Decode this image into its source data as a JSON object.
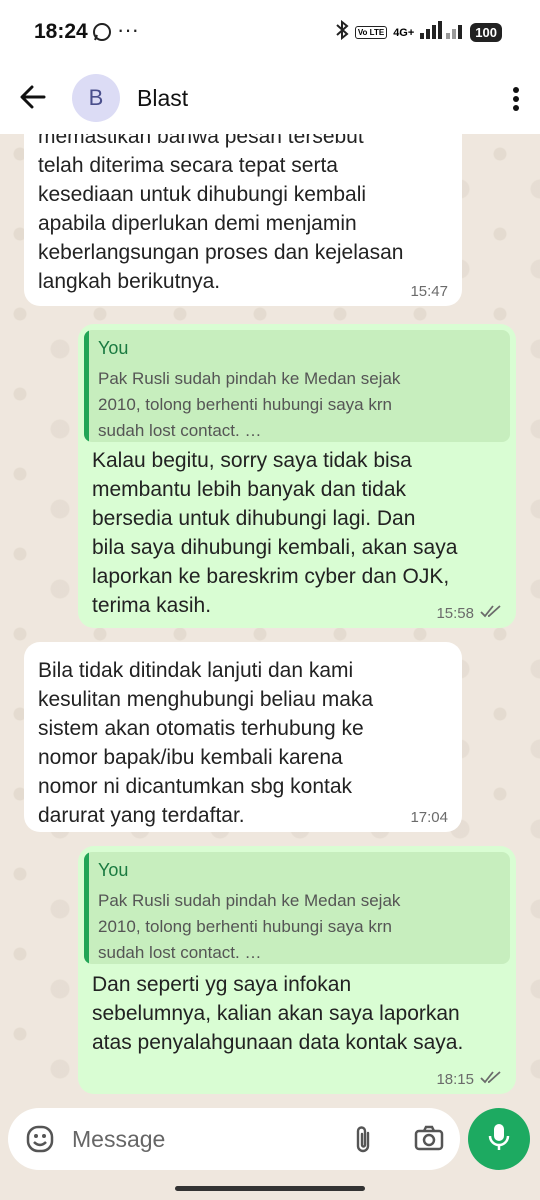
{
  "status_bar": {
    "time": "18:24",
    "dots": "···",
    "network": "4G+",
    "volte": "Vo LTE",
    "battery": "100"
  },
  "header": {
    "avatar_letter": "B",
    "title": "Blast"
  },
  "messages": [
    {
      "direction": "in",
      "text": "memastikan bahwa pesan tersebut\ntelah diterima secara tepat serta\nkesediaan untuk dihubungi kembali\napabila diperlukan demi menjamin\nkeberlangsungan proses dan kejelasan\nlangkah berikutnya.",
      "time": "15:47"
    },
    {
      "direction": "out",
      "quote": {
        "author": "You",
        "text": "Pak Rusli sudah pindah ke Medan sejak\n2010, tolong berhenti hubungi saya krn\nsudah lost contact. …"
      },
      "text": "Kalau begitu, sorry saya tidak bisa\nmembantu lebih banyak dan tidak\nbersedia untuk dihubungi lagi. Dan\nbila saya dihubungi kembali, akan saya\nlaporkan ke bareskrim  cyber dan OJK,\nterima kasih.",
      "time": "15:58"
    },
    {
      "direction": "in",
      "text": "Bila tidak ditindak lanjuti dan kami\nkesulitan menghubungi beliau maka\nsistem akan otomatis terhubung ke\nnomor bapak/ibu  kembali karena\nnomor ni dicantumkan sbg kontak\ndarurat yang terdaftar.",
      "time": "17:04"
    },
    {
      "direction": "out",
      "quote": {
        "author": "You",
        "text": "Pak Rusli sudah pindah ke Medan sejak\n2010, tolong berhenti hubungi saya krn\nsudah lost contact. …"
      },
      "text": "Dan seperti yg saya infokan\nsebelumnya, kalian akan saya laporkan\natas penyalahgunaan data kontak saya.",
      "time": "18:15"
    }
  ],
  "composer": {
    "placeholder": "Message"
  },
  "colors": {
    "incoming": "#ffffff",
    "outgoing": "#d9fdd3",
    "accent": "#1daa61",
    "background": "#efe7de"
  }
}
